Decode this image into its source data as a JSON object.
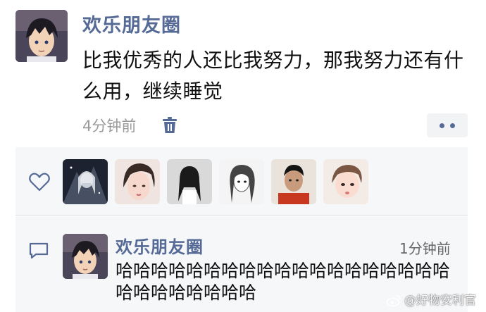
{
  "post": {
    "author": "欢乐朋友圈",
    "text": "比我优秀的人还比我努力，那我努力还有什么用，继续睡觉",
    "time": "4分钟前"
  },
  "icons": {
    "delete": "trash-icon",
    "more": "more-dots-icon",
    "like": "heart-icon",
    "comment": "comment-icon"
  },
  "likes": {
    "count_shown": 6
  },
  "comment": {
    "author": "欢乐朋友圈",
    "time": "1分钟前",
    "text": "哈哈哈哈哈哈哈哈哈哈哈哈哈哈哈哈哈哈哈哈哈哈哈哈哈哈哈"
  },
  "watermark": "@好物安利官",
  "colors": {
    "name_link": "#566a96",
    "panel_bg": "#f6f7f9",
    "meta_gray": "#9a9a9a"
  }
}
